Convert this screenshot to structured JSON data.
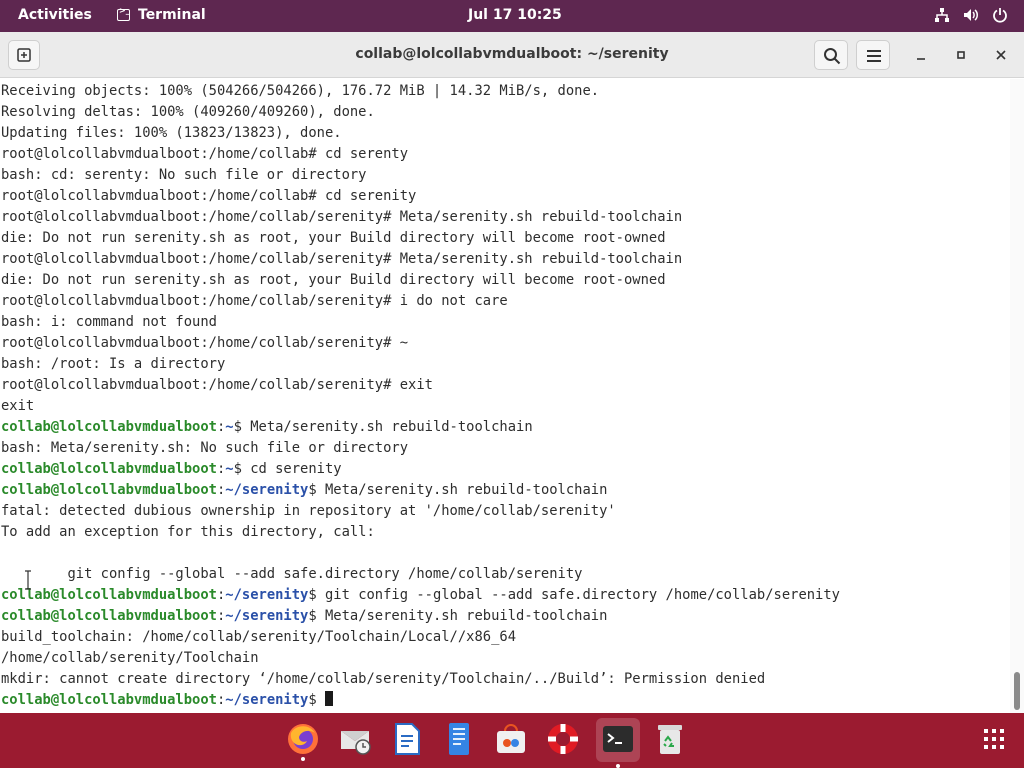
{
  "topbar": {
    "activities": "Activities",
    "app_name": "Terminal",
    "clock": "Jul 17  10:25"
  },
  "window": {
    "title": "collab@lolcollabvmdualboot: ~/serenity"
  },
  "terminal": {
    "lines": [
      [
        {
          "t": "Receiving objects: 100% (504266/504266), 176.72 MiB | 14.32 MiB/s, done."
        }
      ],
      [
        {
          "t": "Resolving deltas: 100% (409260/409260), done."
        }
      ],
      [
        {
          "t": "Updating files: 100% (13823/13823), done."
        }
      ],
      [
        {
          "t": "root@lolcollabvmdualboot:/home/collab# cd serenty"
        }
      ],
      [
        {
          "t": "bash: cd: serenty: No such file or directory"
        }
      ],
      [
        {
          "t": "root@lolcollabvmdualboot:/home/collab# cd serenity"
        }
      ],
      [
        {
          "t": "root@lolcollabvmdualboot:/home/collab/serenity# Meta/serenity.sh rebuild-toolchain"
        }
      ],
      [
        {
          "t": "die: Do not run serenity.sh as root, your Build directory will become root-owned"
        }
      ],
      [
        {
          "t": "root@lolcollabvmdualboot:/home/collab/serenity# Meta/serenity.sh rebuild-toolchain"
        }
      ],
      [
        {
          "t": "die: Do not run serenity.sh as root, your Build directory will become root-owned"
        }
      ],
      [
        {
          "t": "root@lolcollabvmdualboot:/home/collab/serenity# i do not care"
        }
      ],
      [
        {
          "t": "bash: i: command not found"
        }
      ],
      [
        {
          "t": "root@lolcollabvmdualboot:/home/collab/serenity# ~"
        }
      ],
      [
        {
          "t": "bash: /root: Is a directory"
        }
      ],
      [
        {
          "t": "root@lolcollabvmdualboot:/home/collab/serenity# exit"
        }
      ],
      [
        {
          "t": "exit"
        }
      ],
      [
        {
          "t": "collab@lolcollabvmdualboot",
          "c": "user"
        },
        {
          "t": ":"
        },
        {
          "t": "~",
          "c": "path"
        },
        {
          "t": "$ Meta/serenity.sh rebuild-toolchain"
        }
      ],
      [
        {
          "t": "bash: Meta/serenity.sh: No such file or directory"
        }
      ],
      [
        {
          "t": "collab@lolcollabvmdualboot",
          "c": "user"
        },
        {
          "t": ":"
        },
        {
          "t": "~",
          "c": "path"
        },
        {
          "t": "$ cd serenity"
        }
      ],
      [
        {
          "t": "collab@lolcollabvmdualboot",
          "c": "user"
        },
        {
          "t": ":"
        },
        {
          "t": "~/serenity",
          "c": "path"
        },
        {
          "t": "$ Meta/serenity.sh rebuild-toolchain"
        }
      ],
      [
        {
          "t": "fatal: detected dubious ownership in repository at '/home/collab/serenity'"
        }
      ],
      [
        {
          "t": "To add an exception for this directory, call:"
        }
      ],
      [
        {
          "t": ""
        }
      ],
      [
        {
          "t": "        git config --global --add safe.directory /home/collab/serenity"
        }
      ],
      [
        {
          "t": "collab@lolcollabvmdualboot",
          "c": "user"
        },
        {
          "t": ":"
        },
        {
          "t": "~/serenity",
          "c": "path"
        },
        {
          "t": "$ git config --global --add safe.directory /home/collab/serenity"
        }
      ],
      [
        {
          "t": "collab@lolcollabvmdualboot",
          "c": "user"
        },
        {
          "t": ":"
        },
        {
          "t": "~/serenity",
          "c": "path"
        },
        {
          "t": "$ Meta/serenity.sh rebuild-toolchain"
        }
      ],
      [
        {
          "t": "build_toolchain: /home/collab/serenity/Toolchain/Local//x86_64"
        }
      ],
      [
        {
          "t": "/home/collab/serenity/Toolchain"
        }
      ],
      [
        {
          "t": "mkdir: cannot create directory ‘/home/collab/serenity/Toolchain/../Build’: Permission denied"
        }
      ],
      [
        {
          "t": "collab@lolcollabvmdualboot",
          "c": "user"
        },
        {
          "t": ":"
        },
        {
          "t": "~/serenity",
          "c": "path"
        },
        {
          "t": "$ "
        },
        {
          "cursor": true
        }
      ]
    ]
  },
  "dock": {
    "items": [
      {
        "name": "firefox-icon",
        "running": true,
        "active": false
      },
      {
        "name": "thunderbird-icon",
        "running": false,
        "active": false
      },
      {
        "name": "libreoffice-writer-icon",
        "running": false,
        "active": false
      },
      {
        "name": "text-editor-icon",
        "running": false,
        "active": false
      },
      {
        "name": "software-center-icon",
        "running": false,
        "active": false
      },
      {
        "name": "help-icon",
        "running": false,
        "active": false
      },
      {
        "name": "terminal-icon",
        "running": true,
        "active": true
      },
      {
        "name": "trash-icon",
        "running": false,
        "active": false
      }
    ]
  },
  "colors": {
    "topbar": "#5e2750",
    "dock": "#9b1b30",
    "prompt_user": "#2a8a2a",
    "prompt_path": "#2a50a8"
  }
}
